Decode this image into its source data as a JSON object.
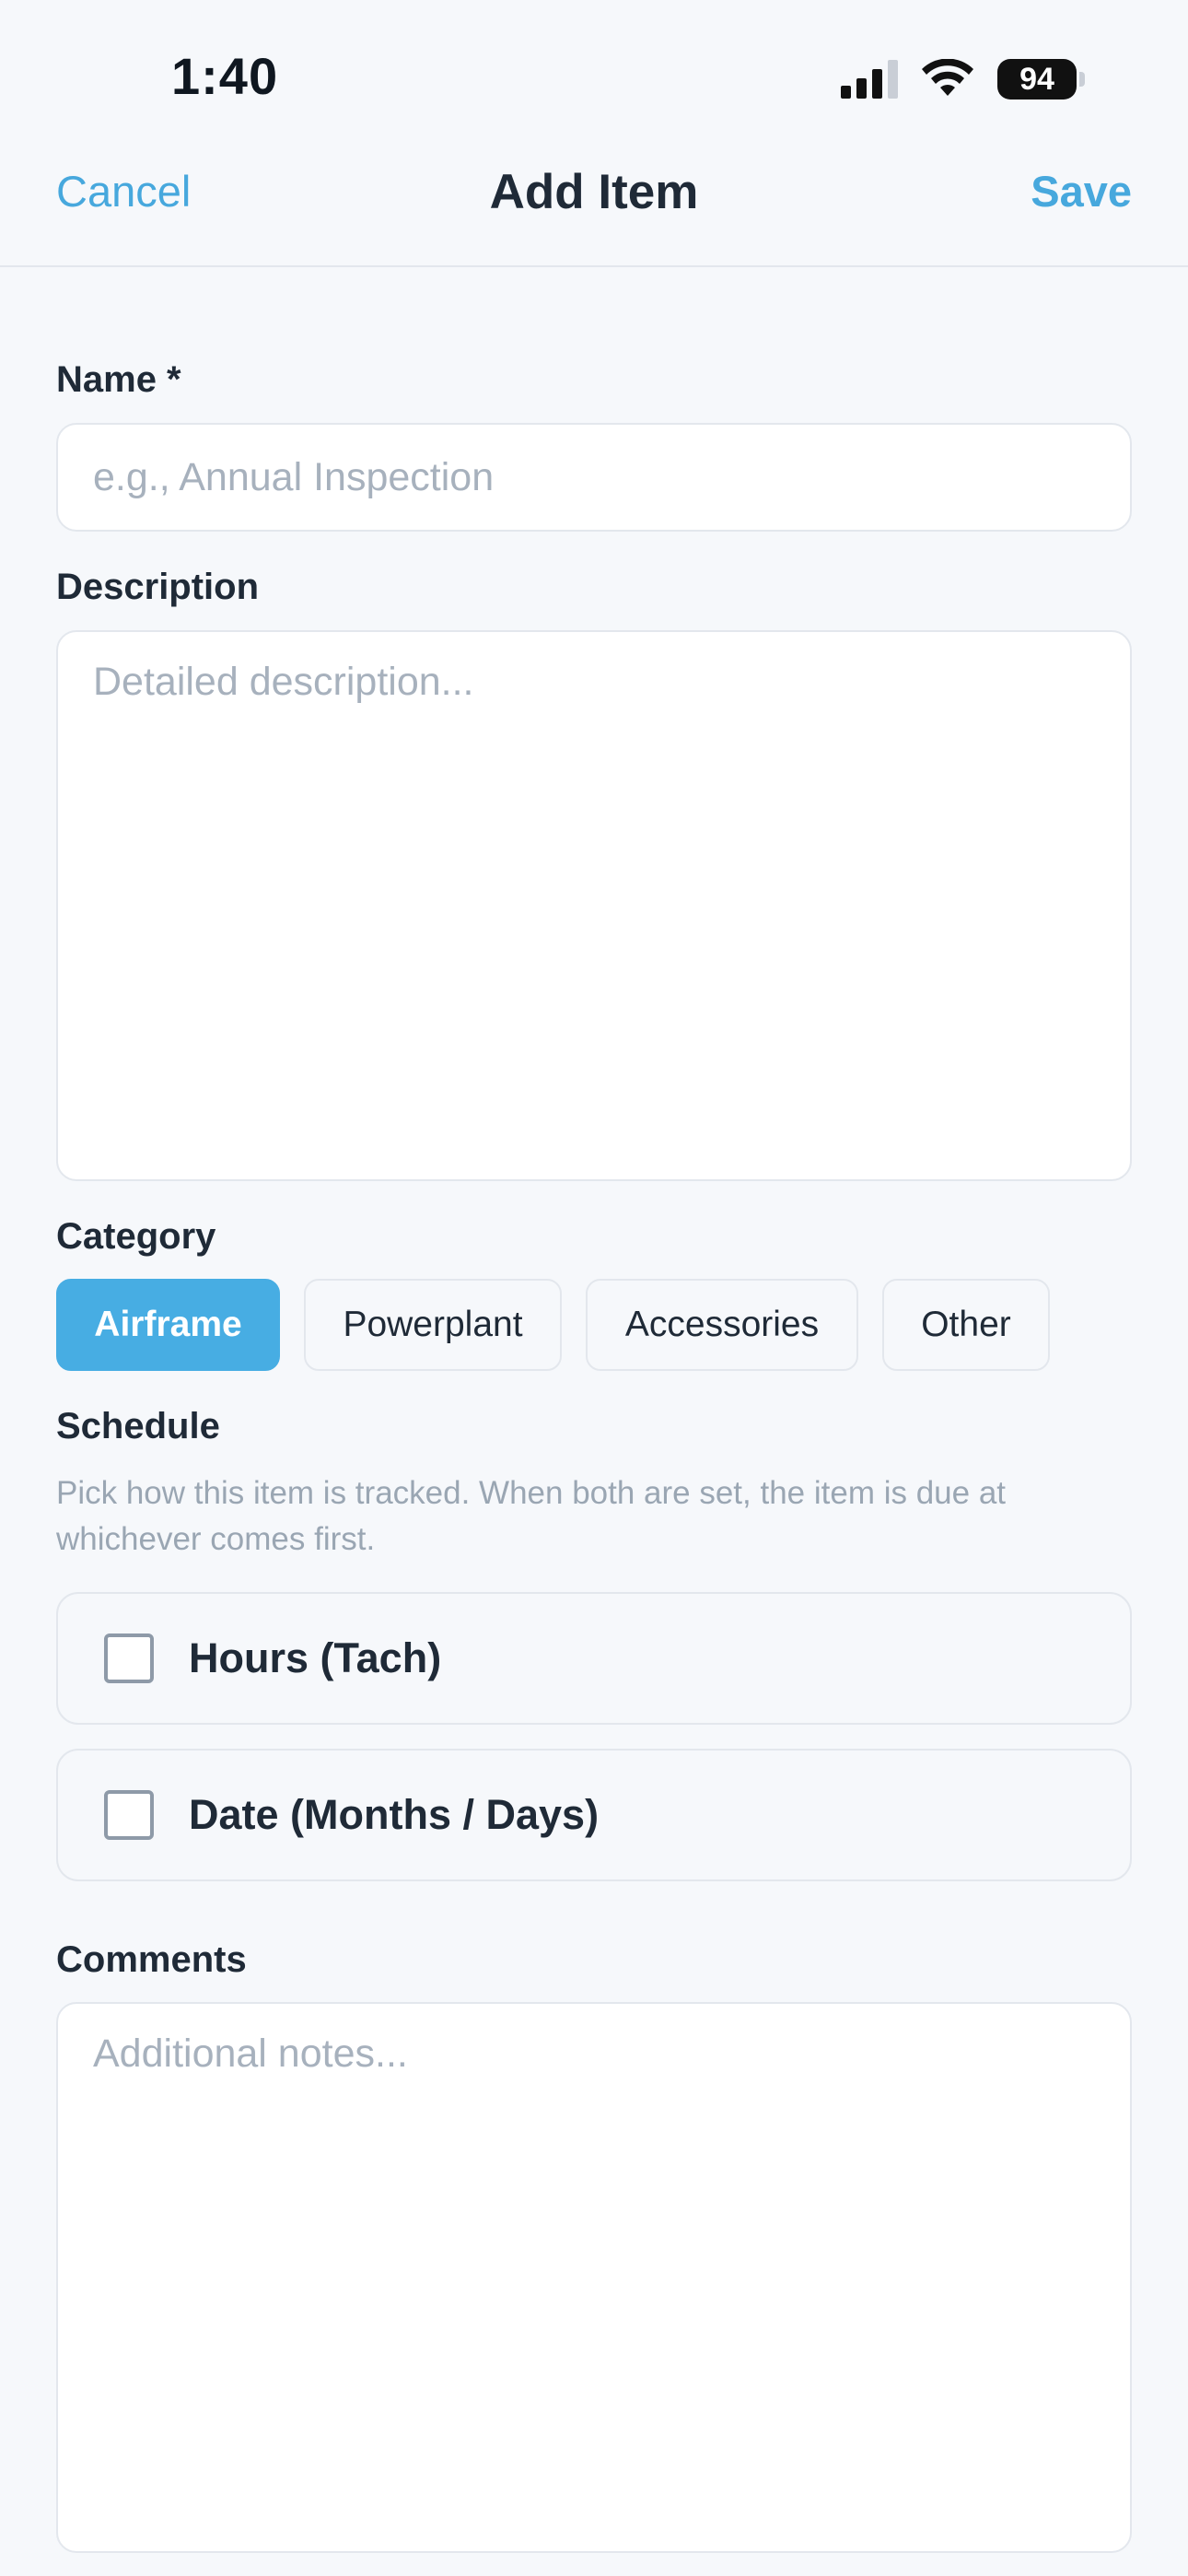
{
  "status_bar": {
    "time": "1:40",
    "battery": "94",
    "icons": [
      "signal-icon",
      "wifi-icon",
      "battery-icon"
    ]
  },
  "nav": {
    "cancel": "Cancel",
    "title": "Add Item",
    "save": "Save"
  },
  "form": {
    "name": {
      "label": "Name *",
      "value": "",
      "placeholder": "e.g., Annual Inspection"
    },
    "description": {
      "label": "Description",
      "value": "",
      "placeholder": "Detailed description..."
    },
    "category": {
      "label": "Category",
      "selected": "Airframe",
      "options": [
        "Airframe",
        "Powerplant",
        "Accessories",
        "Other"
      ]
    },
    "schedule": {
      "label": "Schedule",
      "helper": "Pick how this item is tracked. When both are set, the item is due at whichever comes first.",
      "options": [
        {
          "label": "Hours (Tach)",
          "checked": false
        },
        {
          "label": "Date (Months / Days)",
          "checked": false
        }
      ]
    },
    "comments": {
      "label": "Comments",
      "value": "",
      "placeholder": "Additional notes..."
    }
  },
  "colors": {
    "accent": "#47ade3",
    "link": "#47a8dd",
    "background": "#f6f8fb",
    "text": "#1f2a37",
    "muted": "#9aa6b3",
    "border": "#e3e7ed"
  }
}
